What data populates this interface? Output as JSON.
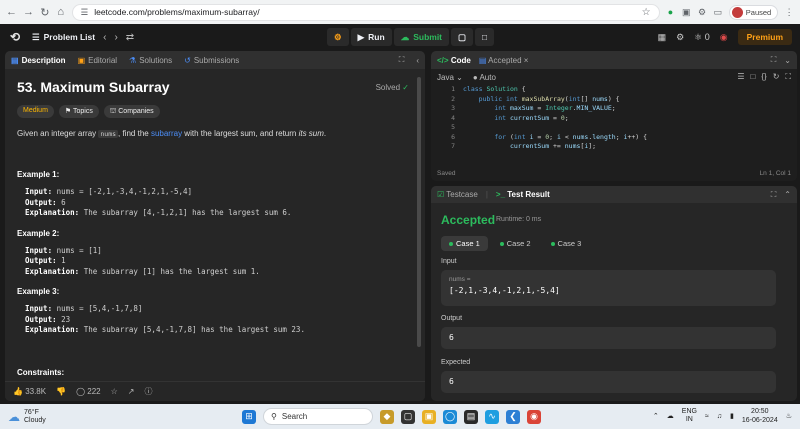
{
  "browser": {
    "url": "leetcode.com/problems/maximum-subarray/",
    "profile_status": "Paused"
  },
  "nav": {
    "problem_list": "Problem List",
    "run": "Run",
    "submit": "Submit",
    "streak": "0",
    "premium": "Premium"
  },
  "left_tabs": [
    "Description",
    "Editorial",
    "Solutions",
    "Submissions"
  ],
  "problem": {
    "title": "53. Maximum Subarray",
    "status": "Solved",
    "difficulty": "Medium",
    "topics": "Topics",
    "companies": "Companies",
    "desc_pre": "Given an integer array ",
    "desc_code": "nums",
    "desc_mid": ", find the ",
    "desc_link": "subarray",
    "desc_post": " with the largest sum, and return ",
    "desc_em": "its sum",
    "desc_end": ".",
    "examples": [
      {
        "heading": "Example 1:",
        "input": "nums = [-2,1,-3,4,-1,2,1,-5,4]",
        "output": "6",
        "explanation": "The subarray [4,-1,2,1] has the largest sum 6."
      },
      {
        "heading": "Example 2:",
        "input": "nums = [1]",
        "output": "1",
        "explanation": "The subarray [1] has the largest sum 1."
      },
      {
        "heading": "Example 3:",
        "input": "nums = [5,4,-1,7,8]",
        "output": "23",
        "explanation": "The subarray [5,4,-1,7,8] has the largest sum 23."
      }
    ],
    "labels": {
      "input": "Input:",
      "output": "Output:",
      "explanation": "Explanation:"
    },
    "constraints": "Constraints:"
  },
  "bottom_bar": {
    "likes": "33.8K",
    "comments": "222"
  },
  "code": {
    "tab": "Code",
    "accepted_tab": "Accepted",
    "language": "Java",
    "auto": "Auto",
    "lines": [
      {
        "n": "1",
        "t": "class Solution {"
      },
      {
        "n": "2",
        "t": "    public int maxSubArray(int[] nums) {"
      },
      {
        "n": "3",
        "t": "        int maxSum = Integer.MIN_VALUE;"
      },
      {
        "n": "4",
        "t": "        int currentSum = 0;"
      },
      {
        "n": "5",
        "t": ""
      },
      {
        "n": "6",
        "t": "        for (int i = 0; i < nums.length; i++) {"
      },
      {
        "n": "7",
        "t": "            currentSum += nums[i];"
      }
    ],
    "saved": "Saved",
    "cursor": "Ln 1, Col 1"
  },
  "result": {
    "testcase_tab": "Testcase",
    "result_tab": "Test Result",
    "status": "Accepted",
    "runtime": "Runtime: 0 ms",
    "cases": [
      "Case 1",
      "Case 2",
      "Case 3"
    ],
    "input_label": "Input",
    "input_var": "nums =",
    "input_value": "[-2,1,-3,4,-1,2,1,-5,4]",
    "output_label": "Output",
    "output_value": "6",
    "expected_label": "Expected",
    "expected_value": "6"
  },
  "taskbar": {
    "temp": "76°F",
    "weather": "Cloudy",
    "search": "Search",
    "lang1": "ENG",
    "lang2": "IN",
    "time": "20:50",
    "date": "16-06-2024"
  },
  "colors": {
    "accent_green": "#2cbb5d",
    "medium": "#ffb800",
    "premium": "#ffa116",
    "link": "#4c8ef8"
  }
}
